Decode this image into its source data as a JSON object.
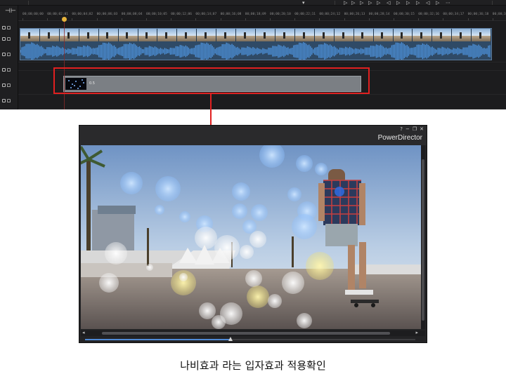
{
  "editor": {
    "ruler_labels": [
      "00;00;00;00",
      "00;00;02;01",
      "00;00;04;02",
      "00;00;06;03",
      "00;00;08;04",
      "00;00;10;05",
      "00;00;12;06",
      "00;00;14;07",
      "00;00;16;08",
      "00;00;18;09",
      "00;00;20;10",
      "00;00;22;11",
      "00;00;24;12",
      "00;00;26;13",
      "00;00;28;14",
      "00;00;30;15",
      "00;00;32;16",
      "00;00;34;17",
      "00;00;36;18",
      "00;00;38;19"
    ],
    "particle_clip_duration": "0.5"
  },
  "preview": {
    "brand": "PowerDirector",
    "help_icon": "?",
    "playback_progress": 0.44
  },
  "caption": "나비효과 라는 입자효과 적용확인",
  "colors": {
    "highlight": "#e02020",
    "video_clip": "#2f4a66",
    "particle_clip": "#7b7f84",
    "progress": "#4f8ad6"
  }
}
